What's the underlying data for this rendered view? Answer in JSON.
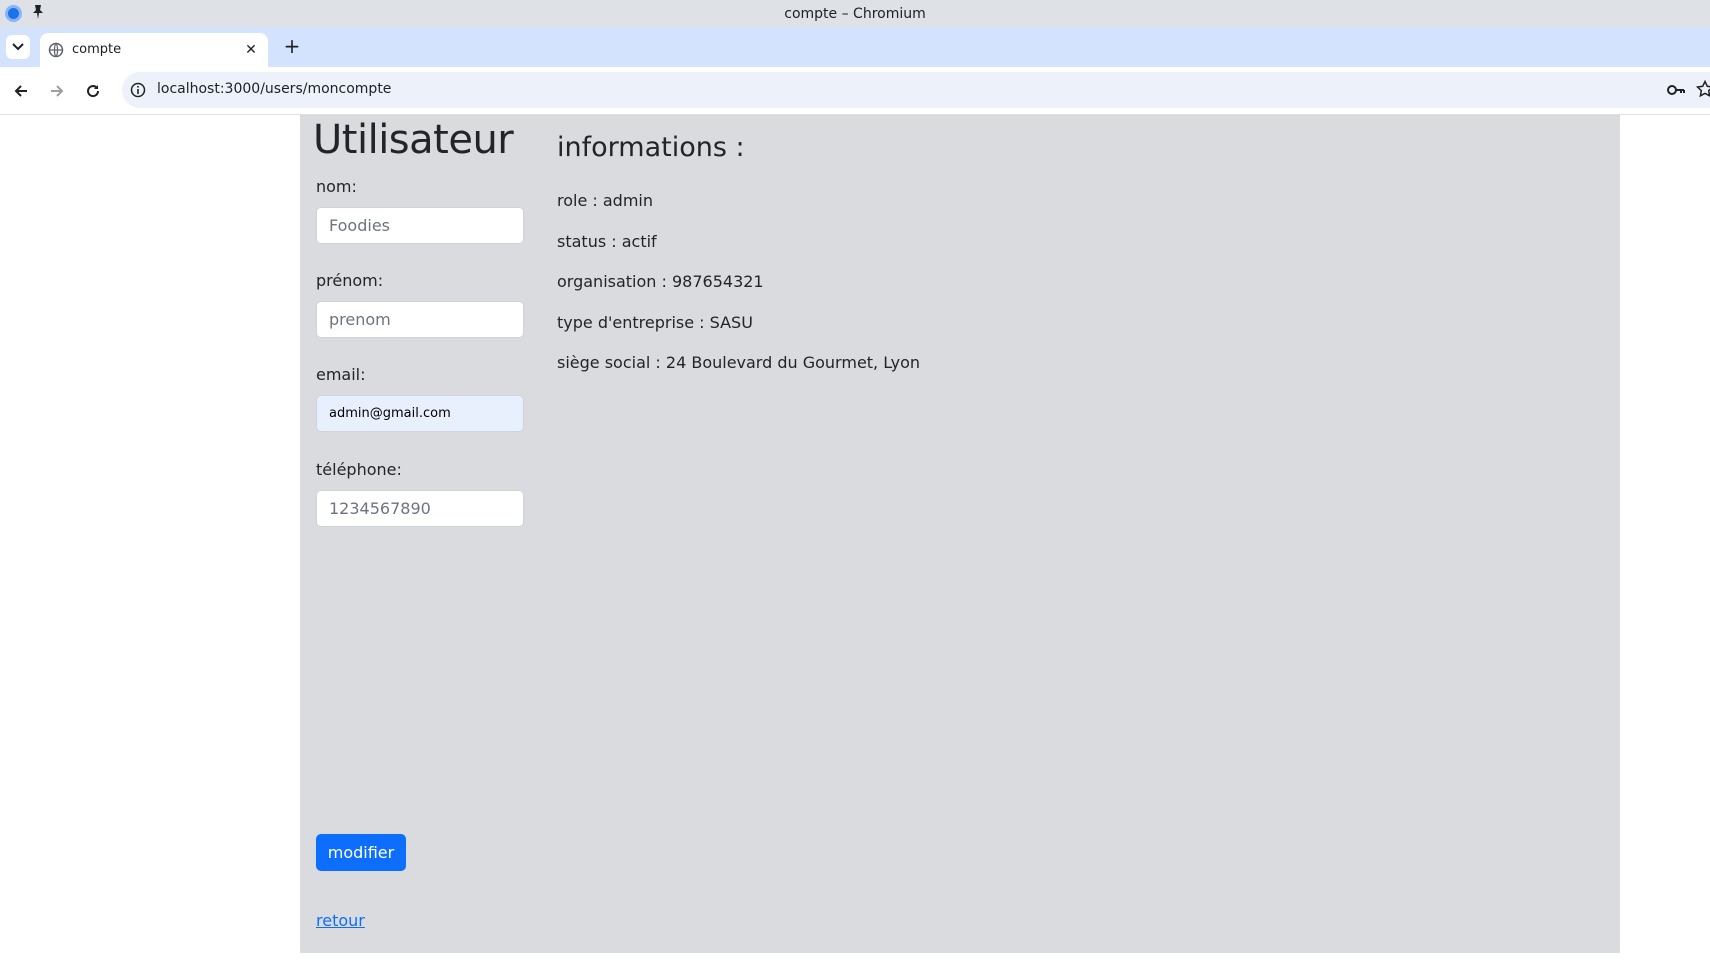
{
  "window": {
    "title": "compte – Chromium"
  },
  "tabs": [
    {
      "title": "compte"
    }
  ],
  "toolbar": {
    "url": "localhost:3000/users/moncompte"
  },
  "user": {
    "title": "Utilisateur",
    "fields": {
      "nom": {
        "label": "nom:",
        "placeholder": "Foodies",
        "value": ""
      },
      "prenom": {
        "label": "prénom:",
        "placeholder": "prenom",
        "value": ""
      },
      "email": {
        "label": "email:",
        "placeholder": "",
        "value": "admin@gmail.com"
      },
      "telephone": {
        "label": "téléphone:",
        "placeholder": "1234567890",
        "value": ""
      }
    },
    "modify_label": "modifier",
    "back_label": "retour"
  },
  "informations": {
    "title": "informations :",
    "lines": [
      "role : admin",
      "status : actif",
      "organisation : 987654321",
      "type d'entreprise : SASU",
      "siège social : 24 Boulevard du Gourmet, Lyon"
    ]
  },
  "colors": {
    "panel": "#dadbde",
    "primary": "#0d6efd",
    "tabstrip": "#d3e3fd"
  },
  "icons": [
    "chromium-icon",
    "pin-icon",
    "tab-list-icon",
    "globe-icon",
    "close-icon",
    "plus-icon",
    "back-icon",
    "forward-icon",
    "reload-icon",
    "info-icon",
    "key-icon",
    "star-icon"
  ]
}
